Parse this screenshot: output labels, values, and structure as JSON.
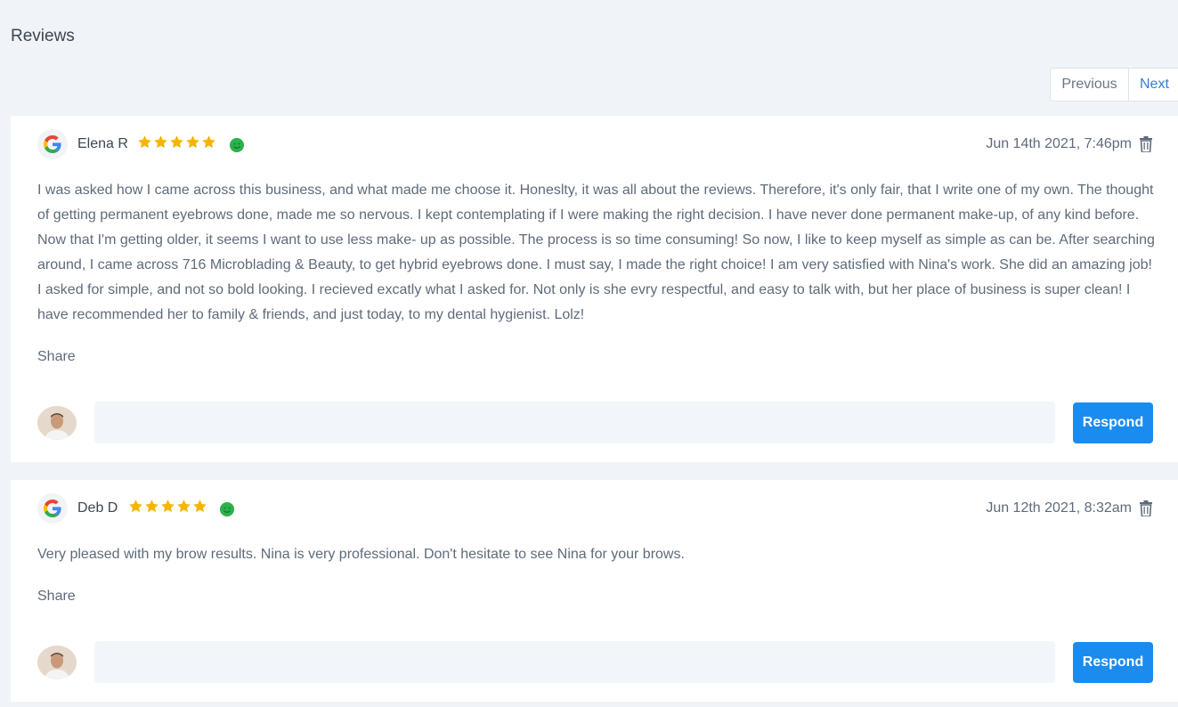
{
  "page": {
    "title": "Reviews"
  },
  "pagination": {
    "previous": "Previous",
    "next": "Next"
  },
  "colors": {
    "accent": "#1a8cf0",
    "star": "#f5b400",
    "sentiment": "#2bb24c",
    "background": "#f0f4f8"
  },
  "reviews": [
    {
      "source_icon": "google-icon",
      "name": "Elena R",
      "rating": 5,
      "date": "Jun 14th 2021, 7:46pm",
      "text": "I was asked how I came across this business, and what made me choose it. Honeslty, it was all about the reviews. Therefore, it's only fair, that I write one of my own. The thought of getting permanent eyebrows done, made me so nervous. I kept contemplating if I were making the right decision. I have never done permanent make-up, of any kind before. Now that I'm getting older, it seems I want to use less make- up as possible. The process is so time consuming! So now, I like to keep myself as simple as can be. After searching around, I came across 716 Microblading & Beauty, to get hybrid eyebrows done. I must say, I made the right choice! I am very satisfied with Nina's work. She did an amazing job! I asked for simple, and not so bold looking. I recieved excatly what I asked for. Not only is she evry respectful, and easy to talk with, but her place of business is super clean! I have recommended her to family & friends, and just today, to my dental hygienist. Lolz!",
      "share": "Share",
      "reply_value": "",
      "respond": "Respond"
    },
    {
      "source_icon": "google-icon",
      "name": "Deb D",
      "rating": 5,
      "date": "Jun 12th 2021, 8:32am",
      "text": "Very pleased with my brow results. Nina is very professional. Don't hesitate to see Nina for your brows.",
      "share": "Share",
      "reply_value": "",
      "respond": "Respond"
    }
  ]
}
